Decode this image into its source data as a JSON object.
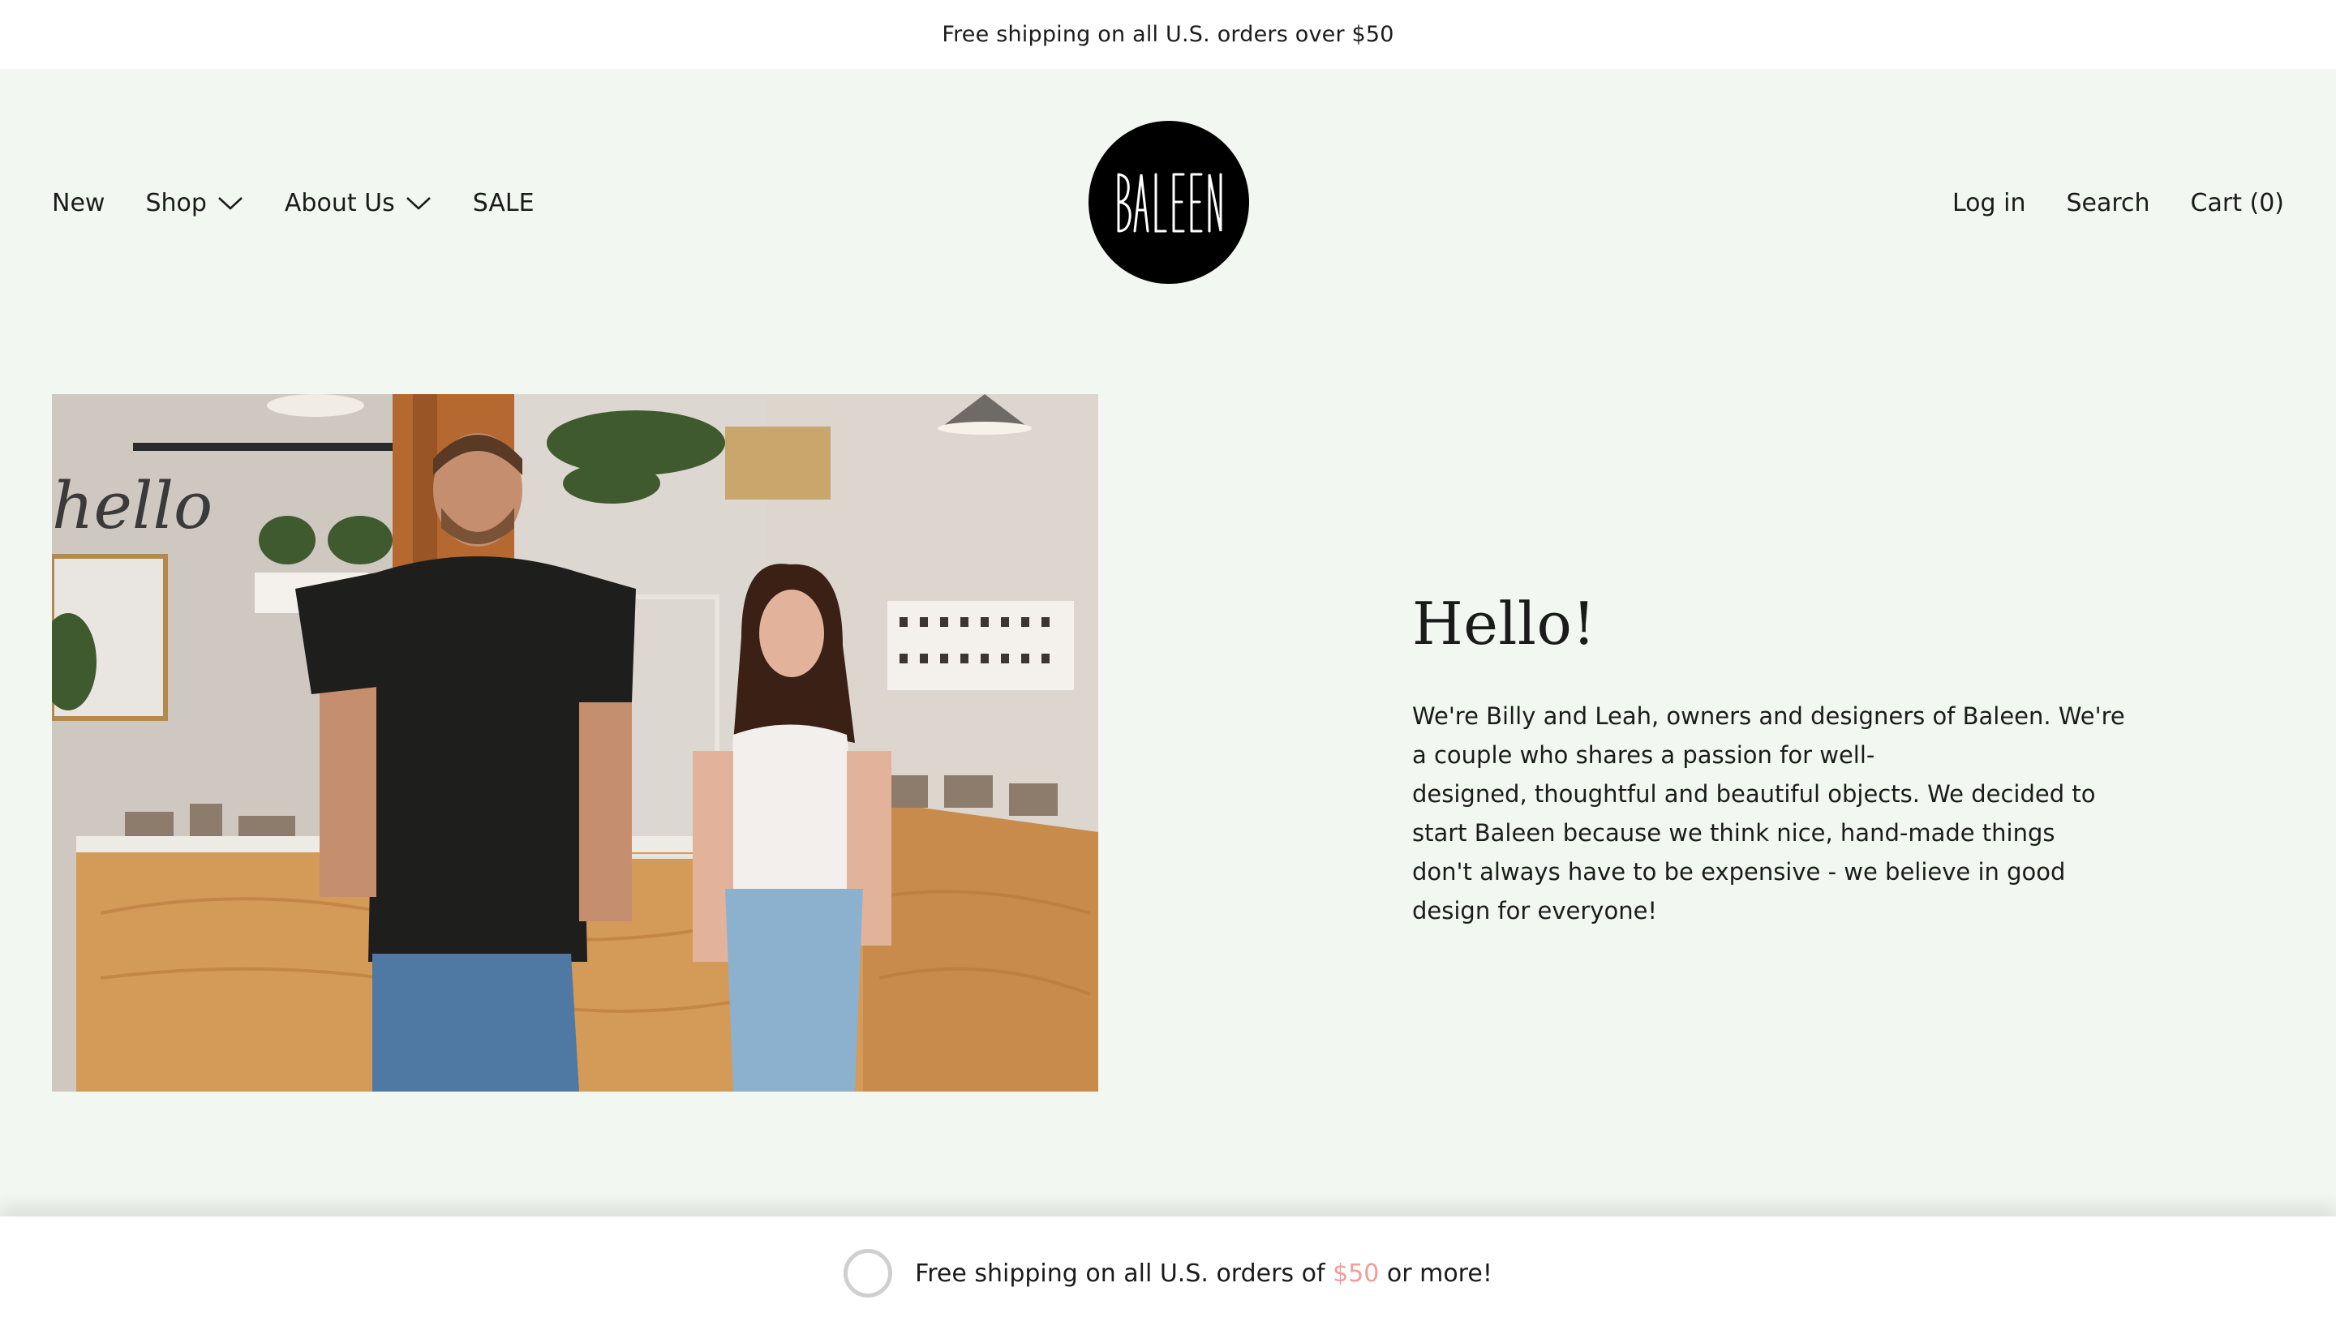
{
  "announcement": {
    "text": "Free shipping on all U.S. orders over $50"
  },
  "nav_left": [
    {
      "label": "New",
      "dropdown": false
    },
    {
      "label": "Shop",
      "dropdown": true
    },
    {
      "label": "About Us",
      "dropdown": true
    },
    {
      "label": "SALE",
      "dropdown": false
    }
  ],
  "logo": {
    "text": "BALEEN"
  },
  "nav_right": {
    "login": "Log in",
    "search": "Search",
    "cart": "Cart (0)"
  },
  "hero": {
    "title": "Hello!",
    "body": "We're Billy and Leah, owners and designers of Baleen. We're\na couple who shares a passion for well-\ndesigned, thoughtful and beautiful objects. We decided to\nstart Baleen because we think nice, hand-made things\ndon't always have to be expensive - we believe in good\ndesign for everyone!"
  },
  "shipping_bar": {
    "prefix": "Free shipping on all U.S. orders of ",
    "amount": "$50",
    "suffix": " or more!",
    "progress": 0
  },
  "colors": {
    "background": "#f2f8f1",
    "accent": "#f39a9a",
    "text": "#1b1b1b"
  }
}
